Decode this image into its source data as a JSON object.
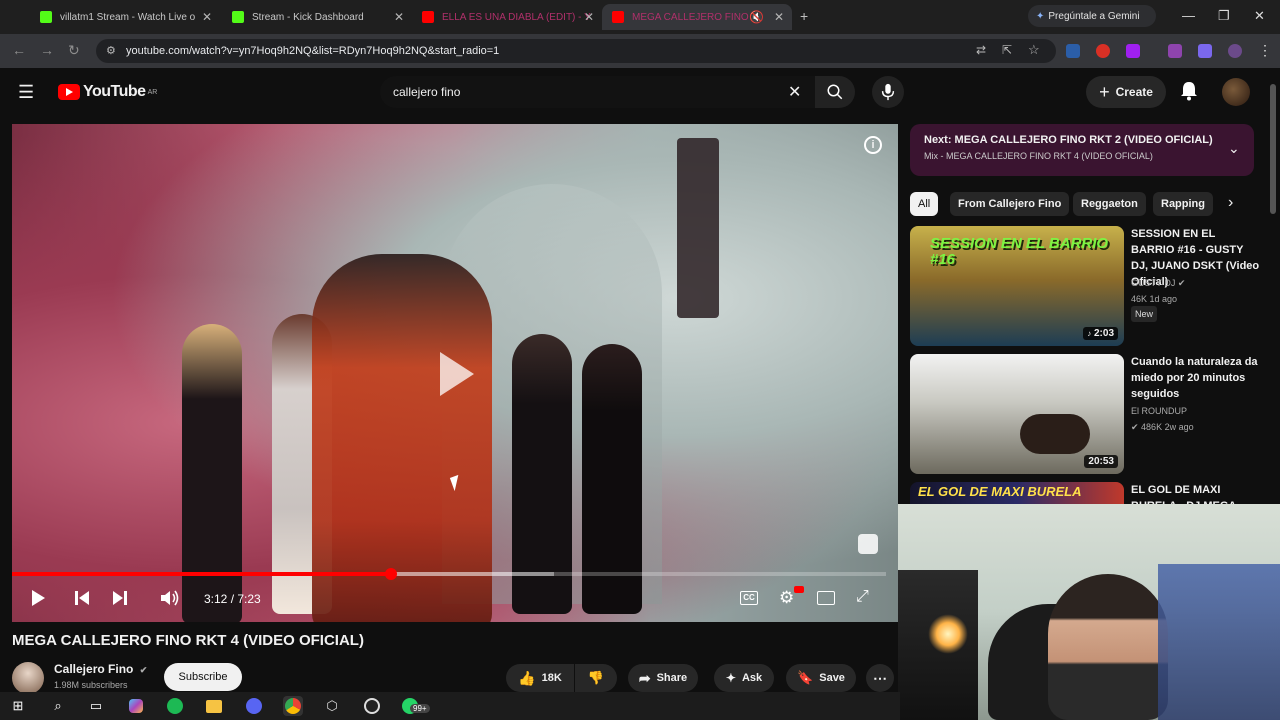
{
  "browser": {
    "tabs": [
      {
        "label": "villatm1 Stream - Watch Live o",
        "favicon_color": "#53fc18"
      },
      {
        "label": "Stream - Kick Dashboard",
        "favicon_color": "#53fc18"
      },
      {
        "label": "ELLA ES UNA DIABLA (EDIT) - Y",
        "favicon_color": "#ff0000"
      },
      {
        "label": "MEGA CALLEJERO FINO RI",
        "favicon_color": "#ff0000"
      }
    ],
    "new_tab": "+",
    "gemini_label": "Pregúntale a Gemini",
    "url": "youtube.com/watch?v=yn7Hoq9h2NQ&list=RDyn7Hoq9h2NQ&start_radio=1"
  },
  "youtube": {
    "logo_text": "YouTube",
    "logo_region": "AR",
    "search_value": "callejero fino",
    "create_label": "Create"
  },
  "player": {
    "time": "3:12 / 7:23",
    "progress_fraction": 0.434,
    "buffer_fraction": 0.62
  },
  "video": {
    "title": "MEGA CALLEJERO FINO RKT 4 (VIDEO OFICIAL)",
    "channel": "Callejero Fino",
    "subscribers": "1.98M subscribers",
    "subscribe_label": "Subscribe",
    "likes": "18K",
    "share_label": "Share",
    "ask_label": "Ask",
    "save_label": "Save"
  },
  "sidebar": {
    "next_title": "Next: MEGA CALLEJERO FINO RKT 2 (VIDEO OFICIAL)",
    "next_sub": "Mix - MEGA CALLEJERO FINO RKT 4 (VIDEO OFICIAL)",
    "chips": [
      "All",
      "From Callejero Fino",
      "Reggaeton",
      "Rapping"
    ],
    "videos": [
      {
        "title": "SESSION EN EL BARRIO #16 - GUSTY DJ, JUANO DSKT (Video Oficial)",
        "channel": "GUSTY DJ",
        "meta": "46K  1d ago",
        "badge": "New",
        "duration": "2:03",
        "thumb_text": "SESSION EN EL BARRIO #16"
      },
      {
        "title": "Cuando la naturaleza da miedo por 20 minutos seguidos",
        "channel": "El ROUNDUP",
        "meta": "486K  2w ago",
        "badge": "",
        "duration": "20:53",
        "thumb_text": ""
      },
      {
        "title": "EL GOL DE MAXI BURELA - DJ MEGA",
        "channel": "",
        "meta": "",
        "badge": "",
        "duration": "",
        "thumb_text": "EL GOL DE MAXI BURELA"
      }
    ]
  },
  "taskbar": {
    "badge": "99+"
  }
}
